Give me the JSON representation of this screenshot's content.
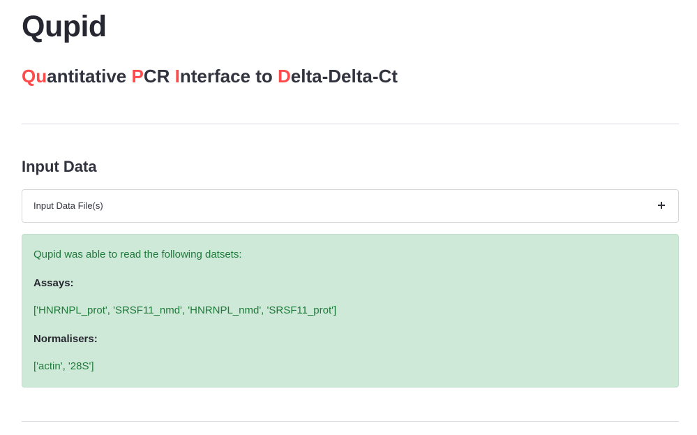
{
  "app": {
    "title": "Qupid",
    "subtitle": {
      "parts": [
        {
          "text": "Qu",
          "highlight": true
        },
        {
          "text": "antitative ",
          "highlight": false
        },
        {
          "text": "P",
          "highlight": true
        },
        {
          "text": "CR ",
          "highlight": false
        },
        {
          "text": "I",
          "highlight": true
        },
        {
          "text": "nterface to ",
          "highlight": false
        },
        {
          "text": "D",
          "highlight": true
        },
        {
          "text": "elta-Delta-Ct",
          "highlight": false
        }
      ]
    }
  },
  "input_section": {
    "heading": "Input Data",
    "expander": {
      "label": "Input Data File(s)",
      "icon": "plus-icon",
      "expanded": false
    }
  },
  "success_message": {
    "intro": "Qupid was able to read the following datsets:",
    "assays_label": "Assays:",
    "assays_value": "['HNRNPL_prot', 'SRSF11_nmd', 'HNRNPL_nmd', 'SRSF11_prot']",
    "normalisers_label": "Normalisers:",
    "normalisers_value": "['actin', '28S']"
  },
  "colors": {
    "accent": "#ff4b4b",
    "success_bg": "#cfe9d8",
    "success_text": "#1e7a3a",
    "text": "#31333f"
  }
}
